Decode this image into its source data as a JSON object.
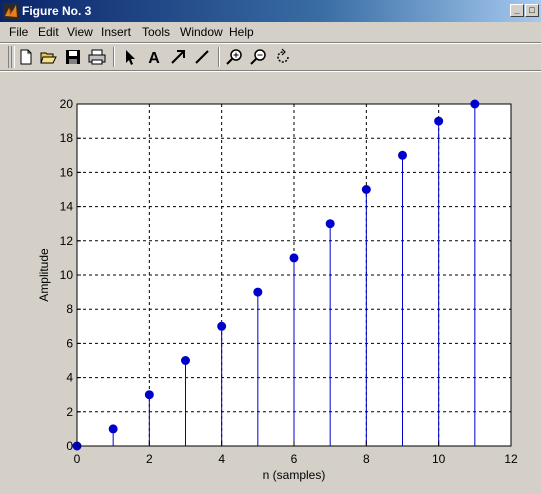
{
  "window": {
    "title": "Figure No. 3"
  },
  "menu": [
    "File",
    "Edit",
    "View",
    "Insert",
    "Tools",
    "Window",
    "Help"
  ],
  "toolbar": {
    "tools": [
      "new-file-icon",
      "open-file-icon",
      "save-icon",
      "print-icon",
      "select-arrow-icon",
      "insert-text-icon",
      "insert-arrow-icon",
      "insert-line-icon",
      "zoom-in-icon",
      "zoom-out-icon",
      "rotate-icon"
    ]
  },
  "chart_data": {
    "type": "stem",
    "x": [
      0,
      1,
      2,
      3,
      4,
      5,
      6,
      7,
      8,
      9,
      10,
      11
    ],
    "y": [
      0,
      1,
      3,
      5,
      7,
      9,
      11,
      13,
      15,
      17,
      19,
      20
    ],
    "xlabel": "n (samples)",
    "ylabel": "Amplitude",
    "xlim": [
      0,
      12
    ],
    "ylim": [
      0,
      20
    ],
    "xticks": [
      0,
      2,
      4,
      6,
      8,
      10,
      12
    ],
    "yticks": [
      0,
      2,
      4,
      6,
      8,
      10,
      12,
      14,
      16,
      18,
      20
    ],
    "grid": true,
    "color": "#0000cc"
  }
}
